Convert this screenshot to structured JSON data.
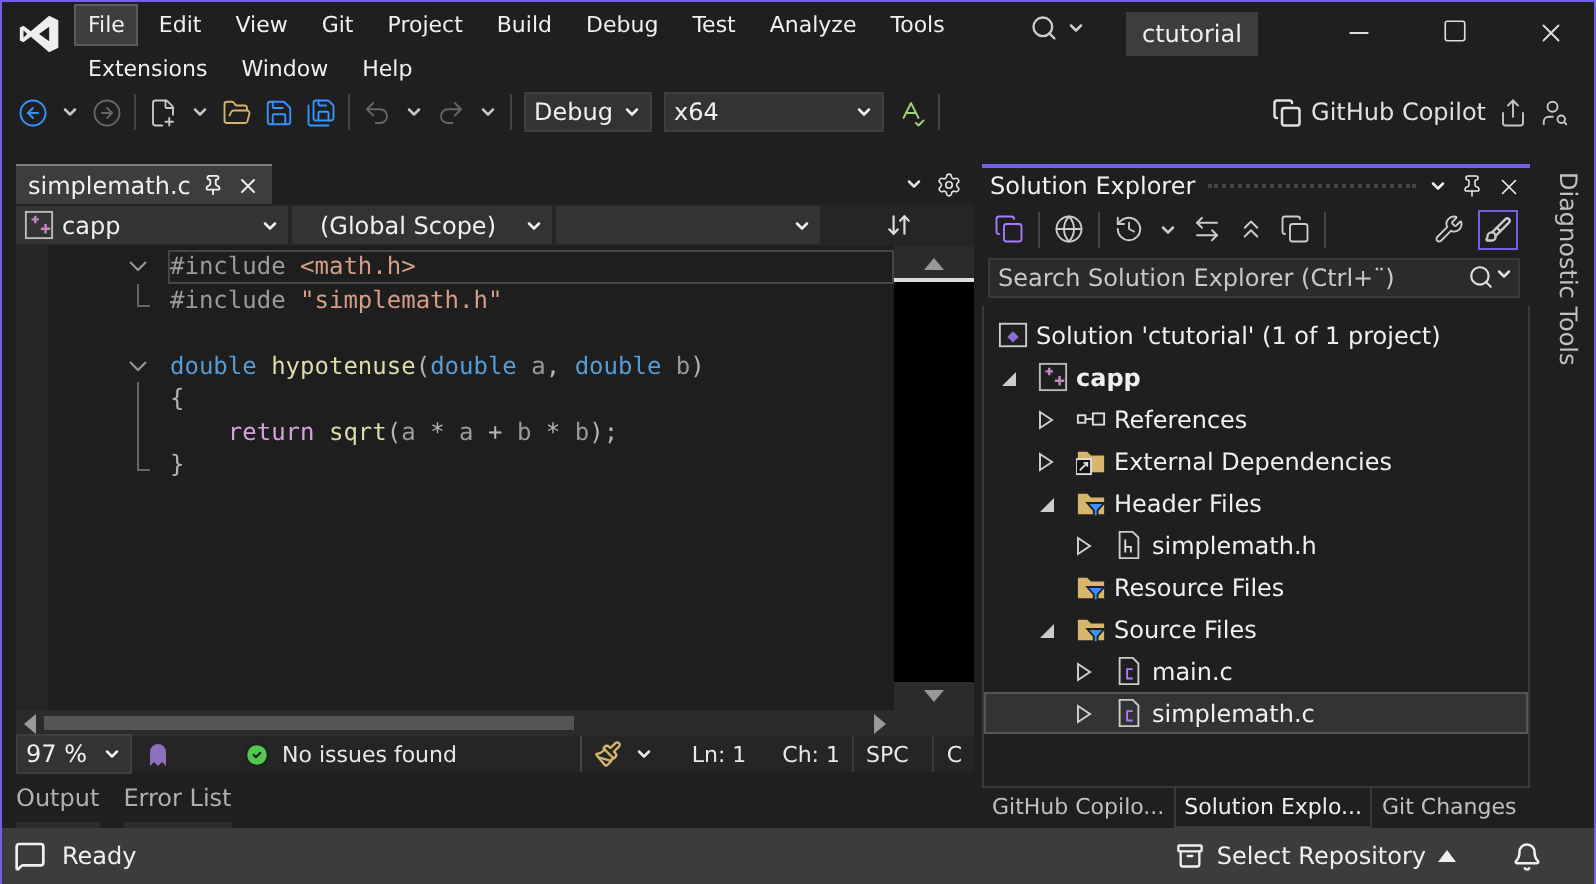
{
  "menu": [
    {
      "label": "File",
      "selected": true
    },
    {
      "label": "Edit",
      "selected": false
    },
    {
      "label": "View",
      "selected": false
    },
    {
      "label": "Git",
      "selected": false
    },
    {
      "label": "Project",
      "selected": false
    },
    {
      "label": "Build",
      "selected": false
    },
    {
      "label": "Debug",
      "selected": false
    },
    {
      "label": "Test",
      "selected": false
    },
    {
      "label": "Analyze",
      "selected": false
    },
    {
      "label": "Tools",
      "selected": false
    },
    {
      "label": "Extensions",
      "selected": false
    },
    {
      "label": "Window",
      "selected": false
    },
    {
      "label": "Help",
      "selected": false
    }
  ],
  "solution_badge": "ctutorial",
  "toolbar": {
    "configuration": "Debug",
    "platform": "x64",
    "copilot": "GitHub Copilot"
  },
  "editor": {
    "tab": {
      "title": "simplemath.c",
      "selected": true
    },
    "nav": {
      "project": "capp",
      "scope": "(Global Scope)"
    },
    "lines": [
      {
        "kind": "start",
        "current": true,
        "tokens": [
          {
            "text": "#include ",
            "kind": "preprocessor"
          },
          {
            "text": "<math.h>",
            "kind": "string"
          }
        ]
      },
      {
        "kind": "end",
        "current": false,
        "tokens": [
          {
            "text": "#include ",
            "kind": "preprocessor"
          },
          {
            "text": "\"simplemath.h\"",
            "kind": "string"
          }
        ]
      },
      {
        "kind": "blank",
        "current": false
      },
      {
        "kind": "start",
        "current": false,
        "tokens": [
          {
            "text": "double ",
            "kind": "keyword"
          },
          {
            "text": "hypotenuse",
            "kind": "function"
          },
          {
            "text": "(",
            "kind": "plain"
          },
          {
            "text": "double ",
            "kind": "keyword"
          },
          {
            "text": "a",
            "kind": "param"
          },
          {
            "text": ", ",
            "kind": "plain"
          },
          {
            "text": "double ",
            "kind": "keyword"
          },
          {
            "text": "b",
            "kind": "param"
          },
          {
            "text": ")",
            "kind": "plain"
          }
        ]
      },
      {
        "kind": "body",
        "current": false,
        "tokens": [
          {
            "text": "{",
            "kind": "plain"
          }
        ]
      },
      {
        "kind": "body",
        "current": false,
        "tokens": [
          {
            "text": "    return ",
            "kind": "control"
          },
          {
            "text": "sqrt",
            "kind": "function"
          },
          {
            "text": "(",
            "kind": "plain"
          },
          {
            "text": "a",
            "kind": "param"
          },
          {
            "text": " * ",
            "kind": "plain"
          },
          {
            "text": "a",
            "kind": "param"
          },
          {
            "text": " + ",
            "kind": "plain"
          },
          {
            "text": "b",
            "kind": "param"
          },
          {
            "text": " * ",
            "kind": "plain"
          },
          {
            "text": "b",
            "kind": "param"
          },
          {
            "text": ");",
            "kind": "plain"
          }
        ]
      },
      {
        "kind": "end",
        "current": false,
        "tokens": [
          {
            "text": "}",
            "kind": "plain"
          }
        ]
      }
    ],
    "status": {
      "zoom": "97 %",
      "issues": "No issues found",
      "line": "Ln: 1",
      "column": "Ch: 1",
      "whitespace": "SPC",
      "column_6": "C"
    }
  },
  "bottom_tabs": [
    {
      "label": "Output"
    },
    {
      "label": "Error List"
    }
  ],
  "solution_explorer": {
    "title": "Solution Explorer",
    "search": {
      "placeholder": "Search Solution Explorer (Ctrl+¨)"
    },
    "tree": [
      {
        "label": "Solution 'ctutorial' (1 of 1 project)",
        "kind": "solution",
        "selected": false,
        "children": [
          {
            "label": "capp",
            "kind": "project",
            "expanded": true,
            "selected": false,
            "children": [
              {
                "label": "References",
                "kind": "references",
                "expanded": false,
                "selected": false
              },
              {
                "label": "External Dependencies",
                "kind": "external",
                "expanded": false,
                "selected": false
              },
              {
                "label": "Header Files",
                "kind": "filter",
                "expanded": true,
                "selected": false,
                "children": [
                  {
                    "label": "simplemath.h",
                    "kind": "header",
                    "expanded": false,
                    "selected": false
                  }
                ]
              },
              {
                "label": "Resource Files",
                "kind": "filter",
                "selected": false
              },
              {
                "label": "Source Files",
                "kind": "filter",
                "expanded": true,
                "selected": false,
                "children": [
                  {
                    "label": "main.c",
                    "kind": "source",
                    "expanded": false,
                    "selected": false
                  },
                  {
                    "label": "simplemath.c",
                    "kind": "source",
                    "expanded": false,
                    "selected": true
                  }
                ]
              }
            ]
          }
        ]
      }
    ],
    "tabs": [
      {
        "label": "GitHub Copilo...",
        "selected": false
      },
      {
        "label": "Solution Explo...",
        "selected": true
      },
      {
        "label": "Git Changes",
        "selected": false
      }
    ]
  },
  "side_tab": "Diagnostic Tools",
  "status_bar": {
    "text": "Ready",
    "repository": "Select Repository"
  }
}
